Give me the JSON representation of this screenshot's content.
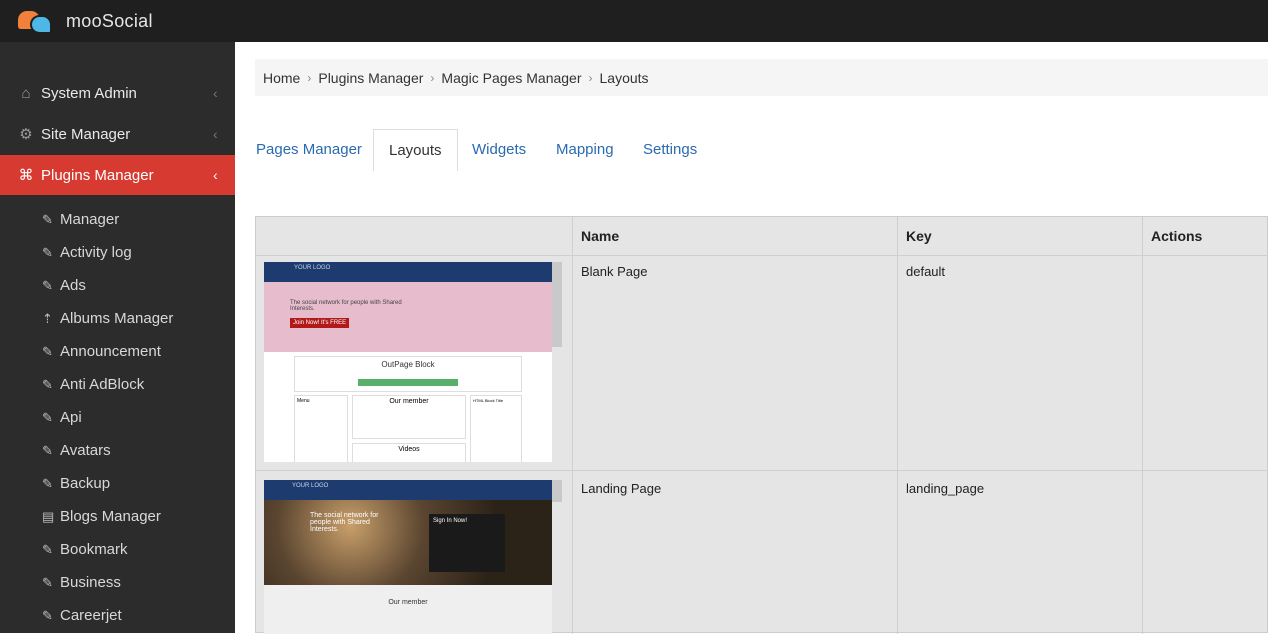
{
  "app": {
    "name": "mooSocial"
  },
  "sidebar": {
    "main_items": [
      {
        "label": "System Admin",
        "icon": "home-icon"
      },
      {
        "label": "Site Manager",
        "icon": "gears-icon"
      },
      {
        "label": "Plugins Manager",
        "icon": "plug-icon"
      }
    ],
    "sub_items": [
      {
        "label": "Manager"
      },
      {
        "label": "Activity log"
      },
      {
        "label": "Ads"
      },
      {
        "label": "Albums Manager"
      },
      {
        "label": "Announcement"
      },
      {
        "label": "Anti AdBlock"
      },
      {
        "label": "Api"
      },
      {
        "label": "Avatars"
      },
      {
        "label": "Backup"
      },
      {
        "label": "Blogs Manager"
      },
      {
        "label": "Bookmark"
      },
      {
        "label": "Business"
      },
      {
        "label": "Careerjet"
      }
    ]
  },
  "breadcrumb": [
    "Home",
    "Plugins Manager",
    "Magic Pages Manager",
    "Layouts"
  ],
  "tabs": [
    {
      "label": "Pages Manager"
    },
    {
      "label": "Layouts"
    },
    {
      "label": "Widgets"
    },
    {
      "label": "Mapping"
    },
    {
      "label": "Settings"
    }
  ],
  "table": {
    "headers": {
      "name": "Name",
      "key": "Key",
      "actions": "Actions"
    },
    "rows": [
      {
        "name": "Blank Page",
        "key": "default"
      },
      {
        "name": "Landing Page",
        "key": "landing_page"
      }
    ]
  },
  "thumb1": {
    "logo": "YOUR LOGO",
    "hero_text": "The social network for people with Shared Interests.",
    "hero_button": "Join Now! It's FREE",
    "block_title": "OutPage Block",
    "member_title": "Our member",
    "videos_title": "Videos",
    "menu_title": "Menu",
    "html_title": "HTML Block Title"
  },
  "thumb2": {
    "logo": "YOUR LOGO",
    "hero_text": "The social network for people with Shared Interests.",
    "signin_title": "Sign In Now!",
    "member_title": "Our member"
  },
  "colors": {
    "accent_red": "#d73a30",
    "link_blue": "#2a6ab0",
    "topbar": "#1f1f1f",
    "sidebar": "#2c2c2c"
  }
}
